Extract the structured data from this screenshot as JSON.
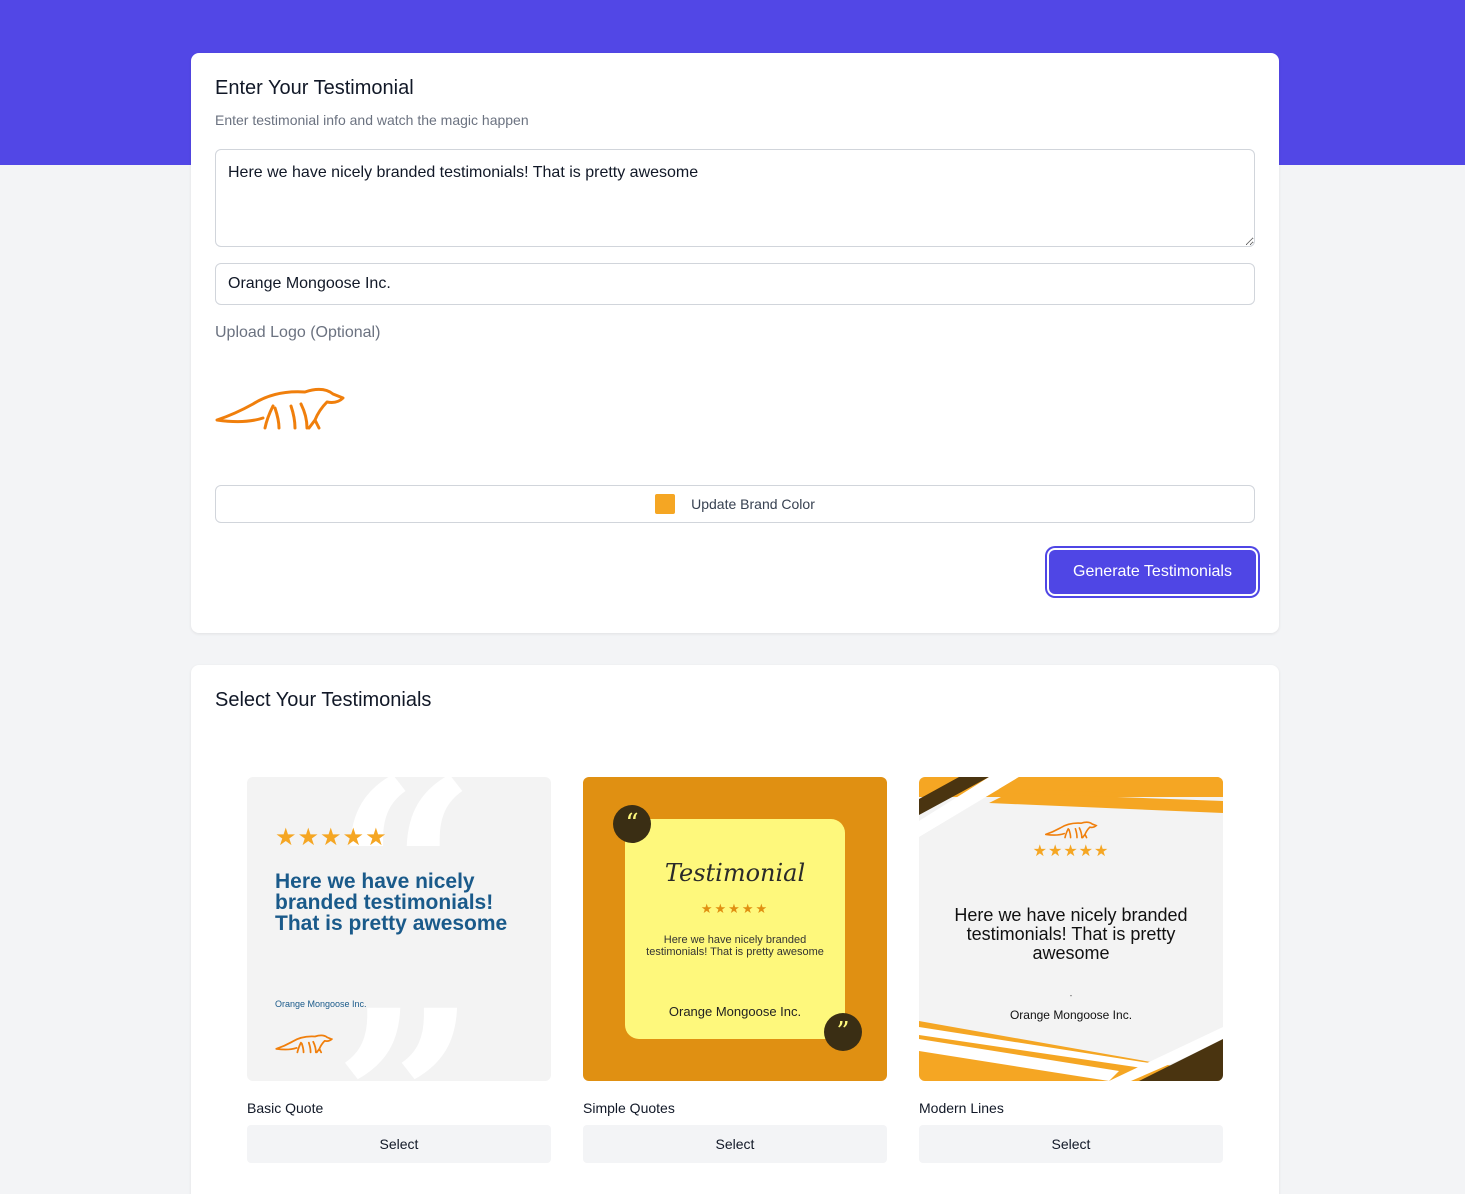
{
  "entry": {
    "title": "Enter Your Testimonial",
    "subtitle": "Enter testimonial info and watch the magic happen",
    "testimonial_text": "Here we have nicely branded testimonials! That is pretty awesome",
    "company_name": "Orange Mongoose Inc.",
    "upload_label": "Upload Logo (Optional)",
    "brand_color_label": "Update Brand Color",
    "brand_color": "#f5a623",
    "generate_label": "Generate Testimonials",
    "logo_icon": "mongoose-logo-icon"
  },
  "selection": {
    "title": "Select Your Testimonials",
    "select_label": "Select",
    "templates": [
      {
        "name": "Basic Quote",
        "stars": "★★★★★",
        "quote": "Here we have nicely branded testimonials! That is pretty awesome",
        "company": "Orange Mongoose Inc.",
        "open_quote": "“",
        "close_quote": "”"
      },
      {
        "name": "Simple Quotes",
        "heading": "Testimonial",
        "stars": "★★★★★",
        "quote": "Here we have nicely branded testimonials! That is pretty awesome",
        "company": "Orange Mongoose Inc.",
        "open_quote": "“",
        "close_quote": "”"
      },
      {
        "name": "Modern Lines",
        "stars": "★★★★★",
        "quote": "Here we have nicely branded testimonials! That is pretty awesome",
        "dash": "-",
        "company": "Orange Mongoose Inc."
      }
    ]
  },
  "colors": {
    "accent": "#4f46e5",
    "header_band": "#5247e6",
    "brand_orange": "#f5a623",
    "dark_brown": "#4a3410",
    "quote_blue": "#1a5a8a"
  }
}
